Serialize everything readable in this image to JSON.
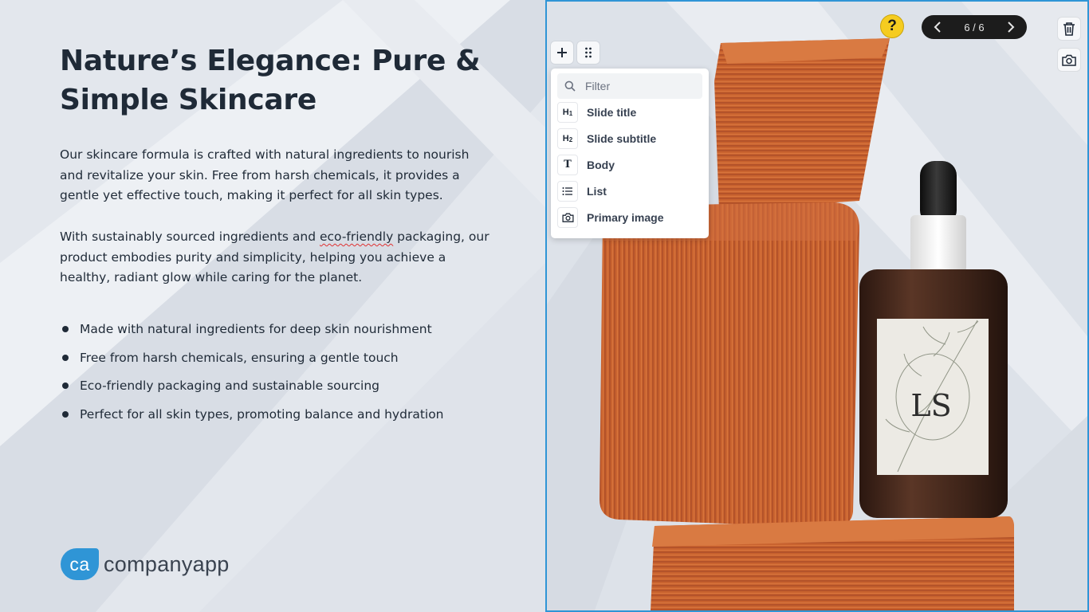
{
  "slide": {
    "title": "Nature’s Elegance: Pure & Simple Skincare",
    "paragraph1": "Our skincare formula is crafted with natural ingredients to nourish and revitalize your skin. Free from harsh chemicals, it provides a gentle yet effective touch, making it perfect for all skin types.",
    "paragraph2_before": "With sustainably sourced ingredients and ",
    "paragraph2_flagged": "eco-friendly",
    "paragraph2_after": " packaging, our product embodies purity and simplicity, helping you achieve a healthy, radiant glow while caring for the planet.",
    "bullets": [
      "Made with natural ingredients for deep skin nourishment",
      "Free from harsh chemicals, ensuring a gentle touch",
      "Eco-friendly packaging and sustainable sourcing",
      "Perfect for all skin types, promoting balance and hydration"
    ],
    "logo": {
      "mark": "ca",
      "text": "companyapp"
    },
    "label_monogram": "LS"
  },
  "toolbar": {
    "help_label": "?",
    "pager_text": "6 / 6",
    "page_current": 6,
    "page_total": 6
  },
  "block_menu": {
    "filter_placeholder": "Filter",
    "items": [
      {
        "icon": "heading-1-icon",
        "icon_text": "H",
        "icon_sub": "1",
        "label": "Slide title"
      },
      {
        "icon": "heading-2-icon",
        "icon_text": "H",
        "icon_sub": "2",
        "label": "Slide subtitle"
      },
      {
        "icon": "text-icon",
        "icon_text": "T",
        "label": "Body"
      },
      {
        "icon": "list-icon",
        "label": "List"
      },
      {
        "icon": "camera-icon",
        "label": "Primary image"
      }
    ]
  },
  "colors": {
    "accent": "#2f95d6",
    "help": "#f5cc20",
    "pager_bg": "#1c1c1c",
    "terracotta": "#c9632f",
    "bottle": "#4a2e22"
  }
}
